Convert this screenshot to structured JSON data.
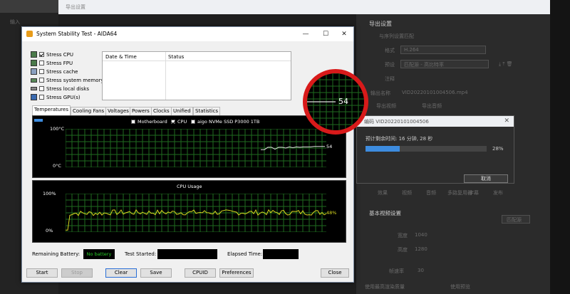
{
  "background": {
    "window_title": "导出设置",
    "left_tab": "输入",
    "export_settings_title": "导出设置",
    "match_sequence": "与序列设置匹配",
    "format_label": "格式",
    "format_value": "H.264",
    "preset_label": "预设",
    "preset_value": "匹配源 - 高比特率",
    "comment_label": "注释",
    "output_label": "输出名称",
    "output_value": "VID20220101004506.mp4",
    "export_video": "导出视频",
    "export_audio": "导出音频",
    "tabs": [
      "效果",
      "视频",
      "音频",
      "多路复用器",
      "字幕",
      "发布"
    ],
    "basic_video": "基本视频设置",
    "match_source_btn": "匹配源",
    "width_label": "宽度",
    "width_value": "1040",
    "height_label": "高度",
    "height_value": "1280",
    "frame_rate_label": "帧速率",
    "frame_rate_value": "30",
    "max_render": "使用最高渲染质量",
    "use_preview": "使用预览"
  },
  "aida": {
    "title": "System Stability Test - AIDA64",
    "checks": [
      {
        "label": "Stress CPU",
        "checked": true
      },
      {
        "label": "Stress FPU",
        "checked": false
      },
      {
        "label": "Stress cache",
        "checked": false
      },
      {
        "label": "Stress system memory",
        "checked": false
      },
      {
        "label": "Stress local disks",
        "checked": false
      },
      {
        "label": "Stress GPU(s)",
        "checked": false
      }
    ],
    "log_headers": {
      "date_time": "Date & Time",
      "status": "Status"
    },
    "tabs": [
      "Temperatures",
      "Cooling Fans",
      "Voltages",
      "Powers",
      "Clocks",
      "Unified",
      "Statistics"
    ],
    "temp_legend": {
      "motherboard": "Motherboard",
      "cpu": "CPU",
      "ssd": "aigo NVMe SSD P3000 1TB"
    },
    "temp_axis": {
      "max": "100°C",
      "min": "0°C"
    },
    "temp_value": "54",
    "usage_title": "CPU Usage",
    "usage_axis": {
      "max": "100%",
      "min": "0%"
    },
    "usage_value": "48%",
    "remaining_battery_label": "Remaining Battery:",
    "remaining_battery_value": "No battery",
    "test_started_label": "Test Started:",
    "elapsed_label": "Elapsed Time:",
    "buttons": [
      "Start",
      "Stop",
      "Clear",
      "Save",
      "CPUID",
      "Preferences",
      "Close"
    ],
    "zoom_value": "54"
  },
  "export_dialog": {
    "title": "编码 VID20220101004506",
    "remaining": "预计剩余时间: 16 分钟, 28 秒",
    "percent_text": "28%",
    "progress": 0.28,
    "cancel": "取消"
  },
  "colors": {
    "graph_grid": "#1f6b1f",
    "temp_line": "#e0e0e0",
    "usage_line": "#d8d820",
    "progress": "#3d8cdf",
    "callout": "#d81a1a"
  }
}
